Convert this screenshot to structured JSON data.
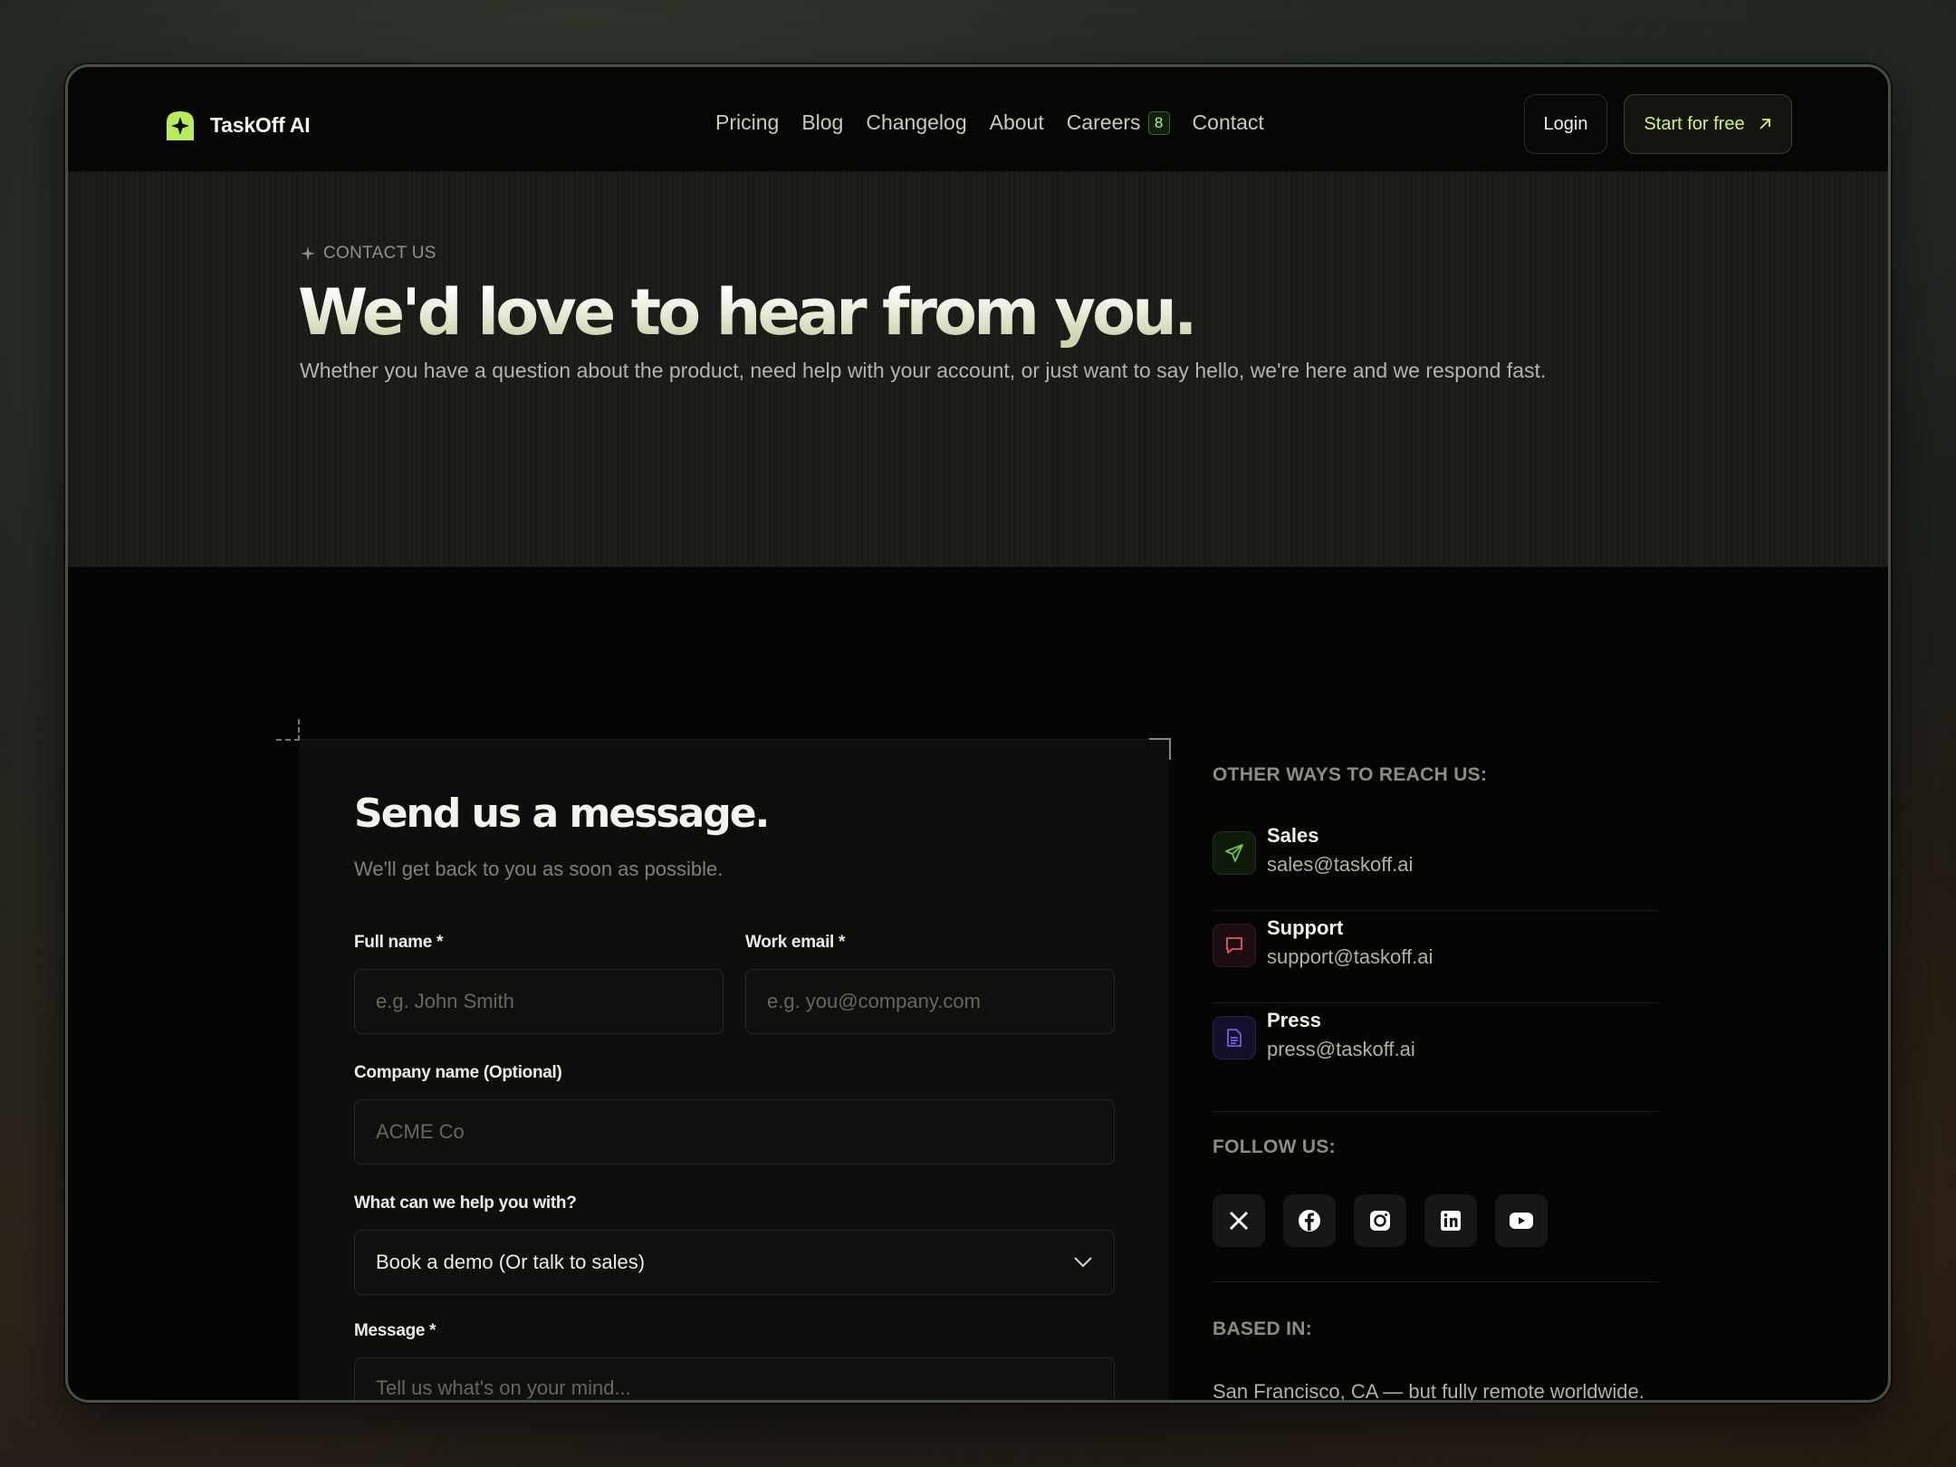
{
  "header": {
    "logo_text": "TaskOff AI",
    "nav": [
      {
        "label": "Pricing"
      },
      {
        "label": "Blog"
      },
      {
        "label": "Changelog"
      },
      {
        "label": "About"
      },
      {
        "label": "Careers",
        "badge": "8"
      },
      {
        "label": "Contact"
      }
    ],
    "login_label": "Login",
    "start_label": "Start for free"
  },
  "hero": {
    "eyebrow": "CONTACT US",
    "title": "We'd love to hear from you.",
    "subtitle": "Whether you have a question about the product, need help with your account, or just want to say hello, we're here and we respond fast."
  },
  "form": {
    "title": "Send us a message.",
    "subtitle": "We'll get back to you as soon as possible.",
    "full_name_label": "Full name *",
    "full_name_placeholder": "e.g. John Smith",
    "email_label": "Work email *",
    "email_placeholder": "e.g. you@company.com",
    "company_label": "Company name (Optional)",
    "company_placeholder": "ACME Co",
    "help_label": "What can we help you with?",
    "help_value": "Book a demo (Or talk to sales)",
    "message_label": "Message *",
    "message_placeholder": "Tell us what's on your mind..."
  },
  "side": {
    "reach_heading": "OTHER WAYS TO REACH US:",
    "contacts": [
      {
        "title": "Sales",
        "email": "sales@taskoff.ai",
        "icon": "send-icon",
        "color": "#6fc24a"
      },
      {
        "title": "Support",
        "email": "support@taskoff.ai",
        "icon": "chat-icon",
        "color": "#e0566a"
      },
      {
        "title": "Press",
        "email": "press@taskoff.ai",
        "icon": "document-icon",
        "color": "#7a5ce6"
      }
    ],
    "follow_heading": "FOLLOW US:",
    "socials": [
      "x-icon",
      "facebook-icon",
      "instagram-icon",
      "linkedin-icon",
      "youtube-icon"
    ],
    "based_heading": "BASED IN:",
    "based_text": "San Francisco, CA — but fully remote worldwide."
  },
  "colors": {
    "accent": "#d8f26a",
    "logo_green": "#b8ec5a",
    "background": "#050604"
  }
}
